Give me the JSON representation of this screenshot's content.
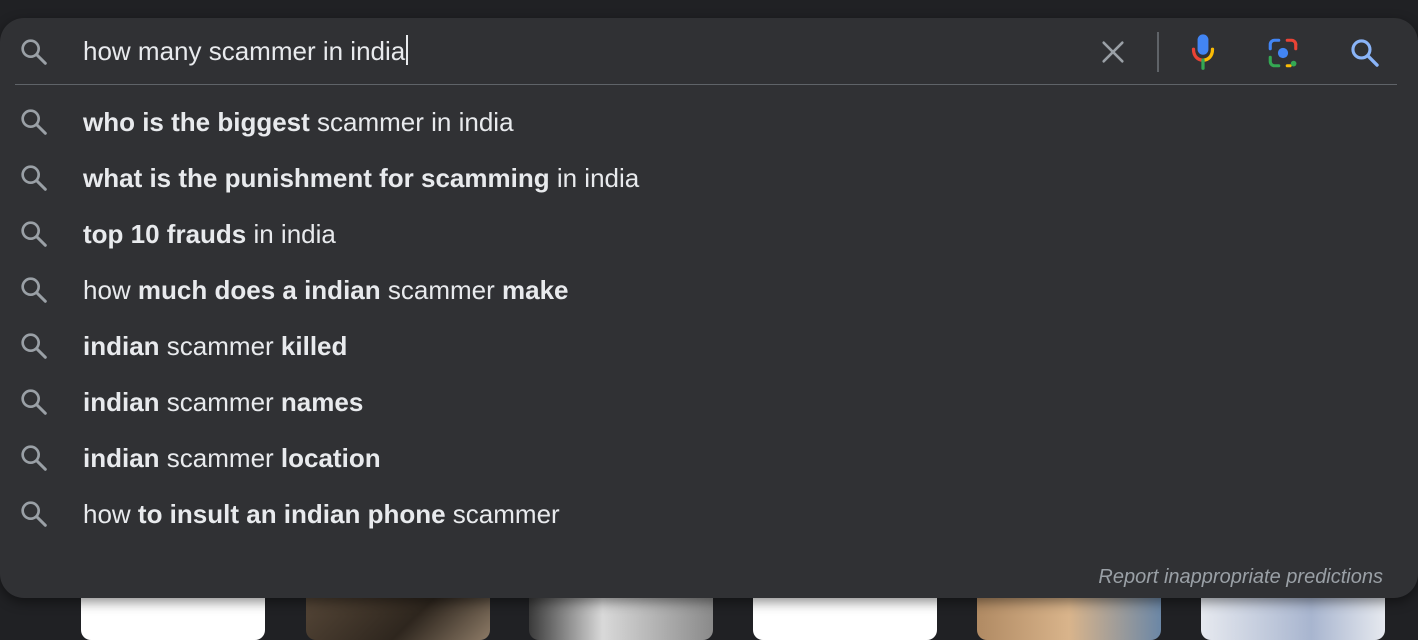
{
  "search": {
    "query": "how many scammer in india"
  },
  "icons": {
    "search_left": "search-icon",
    "clear": "close-icon",
    "voice": "microphone-icon",
    "lens": "camera-lens-icon",
    "search_submit": "search-icon"
  },
  "colors": {
    "panel_bg": "#303134",
    "page_bg": "#202124",
    "text": "#e8eaed",
    "muted": "#9aa0a6",
    "accent_blue": "#8ab4f8"
  },
  "suggestions": [
    {
      "parts": [
        {
          "t": "who is the biggest",
          "b": true
        },
        {
          "t": " scammer in india",
          "b": false
        }
      ]
    },
    {
      "parts": [
        {
          "t": "what is the punishment for scamming",
          "b": true
        },
        {
          "t": " in india",
          "b": false
        }
      ]
    },
    {
      "parts": [
        {
          "t": "top 10 frauds",
          "b": true
        },
        {
          "t": " in india",
          "b": false
        }
      ]
    },
    {
      "parts": [
        {
          "t": "how ",
          "b": false
        },
        {
          "t": "much does a indian",
          "b": true
        },
        {
          "t": " scammer ",
          "b": false
        },
        {
          "t": "make",
          "b": true
        }
      ]
    },
    {
      "parts": [
        {
          "t": "indian",
          "b": true
        },
        {
          "t": " scammer ",
          "b": false
        },
        {
          "t": "killed",
          "b": true
        }
      ]
    },
    {
      "parts": [
        {
          "t": "indian",
          "b": true
        },
        {
          "t": " scammer ",
          "b": false
        },
        {
          "t": "names",
          "b": true
        }
      ]
    },
    {
      "parts": [
        {
          "t": "indian",
          "b": true
        },
        {
          "t": " scammer ",
          "b": false
        },
        {
          "t": "location",
          "b": true
        }
      ]
    },
    {
      "parts": [
        {
          "t": "how ",
          "b": false
        },
        {
          "t": "to insult an indian phone",
          "b": true
        },
        {
          "t": " scammer",
          "b": false
        }
      ]
    }
  ],
  "footer": {
    "report_label": "Report inappropriate predictions"
  }
}
